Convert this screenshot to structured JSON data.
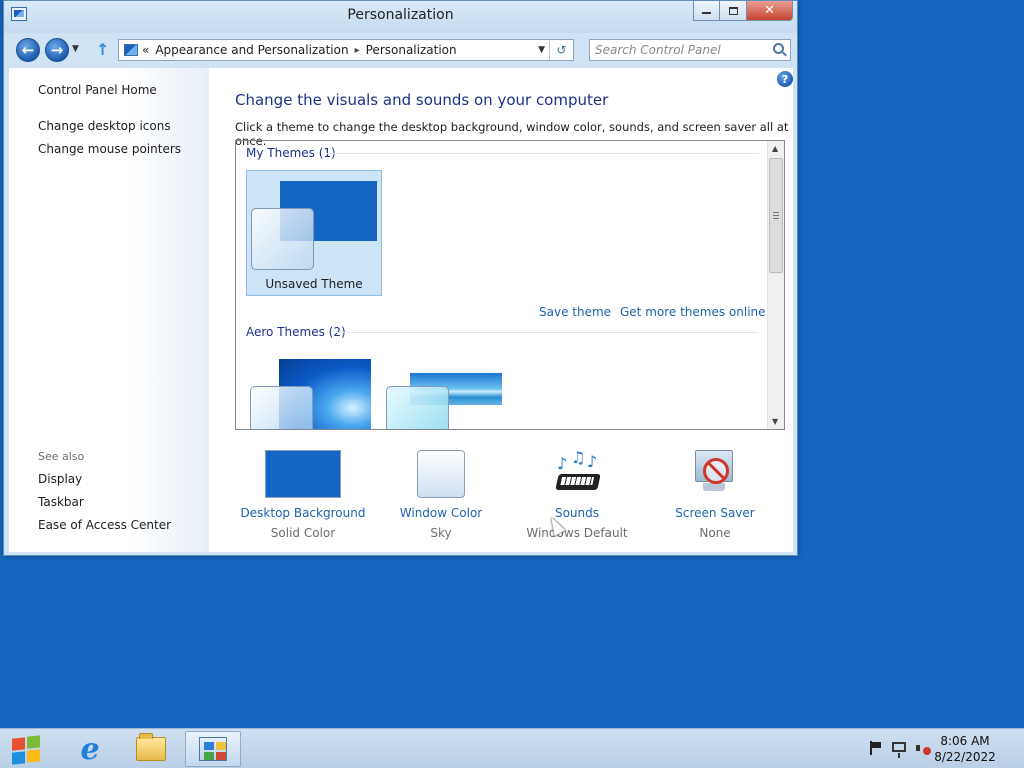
{
  "window": {
    "title": "Personalization",
    "close_glyph": "✕"
  },
  "address": {
    "crumb_chevron": "«",
    "crumb_parent": "Appearance and Personalization",
    "crumb_separator": "▸",
    "crumb_current": "Personalization",
    "search_placeholder": "Search Control Panel"
  },
  "sidebar": {
    "home": "Control Panel Home",
    "links": [
      "Change desktop icons",
      "Change mouse pointers"
    ],
    "see_also_title": "See also",
    "see_also": [
      "Display",
      "Taskbar",
      "Ease of Access Center"
    ]
  },
  "main": {
    "help_glyph": "?",
    "heading": "Change the visuals and sounds on your computer",
    "subheading": "Click a theme to change the desktop background, window color, sounds, and screen saver all at once.",
    "my_themes_title": "My Themes (1)",
    "my_theme_name": "Unsaved Theme",
    "save_theme": "Save theme",
    "get_more_themes": "Get more themes online",
    "aero_themes_title": "Aero Themes (2)",
    "settings": [
      {
        "label": "Desktop Background",
        "value": "Solid Color"
      },
      {
        "label": "Window Color",
        "value": "Sky"
      },
      {
        "label": "Sounds",
        "value": "Windows Default"
      },
      {
        "label": "Screen Saver",
        "value": "None"
      }
    ]
  },
  "taskbar": {
    "time": "8:06 AM",
    "date": "8/22/2022",
    "ie_glyph": "e"
  },
  "colors": {
    "desktop": "#1566c0",
    "link": "#1f62ad",
    "heading": "#1e3287",
    "solid_background": "#1366c4"
  },
  "icons": [
    "windows-logo-icon",
    "internet-explorer-icon",
    "file-explorer-icon",
    "control-panel-icon",
    "action-center-flag-icon",
    "network-icon",
    "volume-muted-icon",
    "help-icon",
    "search-icon"
  ]
}
